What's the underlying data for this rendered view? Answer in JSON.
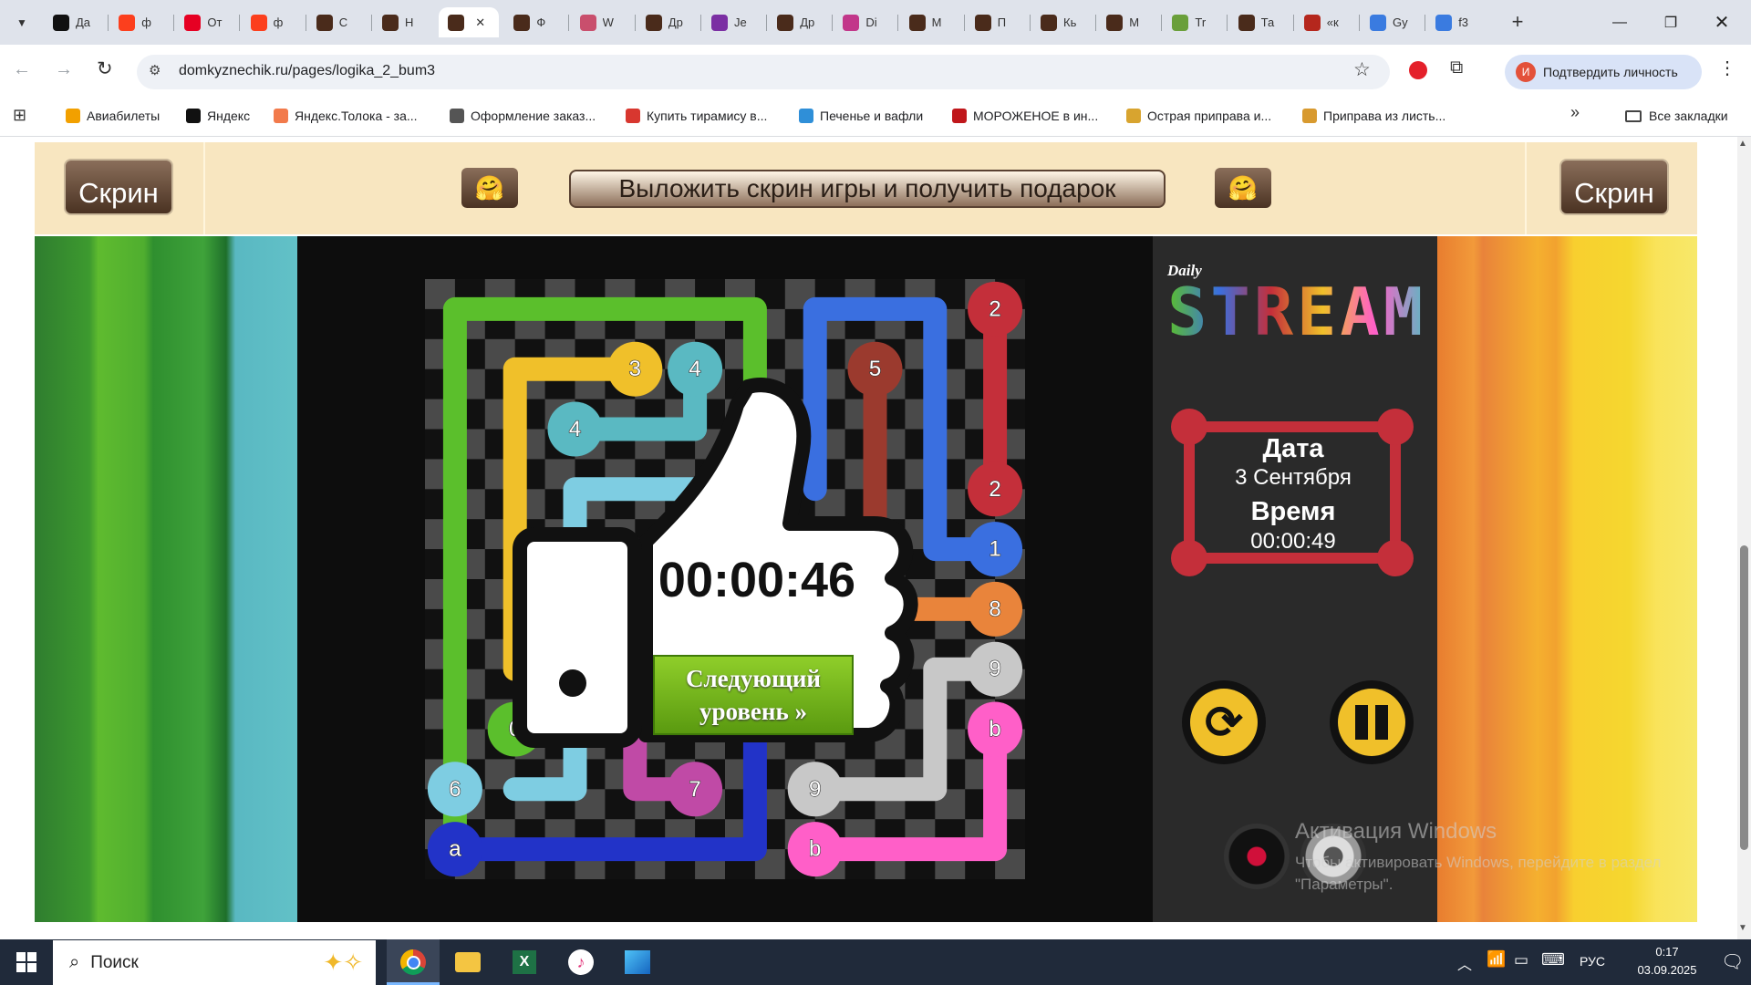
{
  "browser": {
    "tabs": [
      {
        "label": "Да",
        "color": "#111"
      },
      {
        "label": "ф",
        "color": "#fc3f1d"
      },
      {
        "label": "От",
        "color": "#e60023"
      },
      {
        "label": "ф",
        "color": "#fc3f1d"
      },
      {
        "label": "С",
        "color": "#4a2b1b"
      },
      {
        "label": "Н",
        "color": "#4a2b1b"
      },
      {
        "label": "",
        "color": "#4a2b1b",
        "active": true
      },
      {
        "label": "Ф",
        "color": "#4a2b1b"
      },
      {
        "label": "W",
        "color": "#c94f6d"
      },
      {
        "label": "Др",
        "color": "#4a2b1b"
      },
      {
        "label": "Je",
        "color": "#7b2fa3"
      },
      {
        "label": "Др",
        "color": "#4a2b1b"
      },
      {
        "label": "Di",
        "color": "#c2378a"
      },
      {
        "label": "М",
        "color": "#4a2b1b"
      },
      {
        "label": "П",
        "color": "#4a2b1b"
      },
      {
        "label": "Кь",
        "color": "#4a2b1b"
      },
      {
        "label": "М",
        "color": "#4a2b1b"
      },
      {
        "label": "Tr",
        "color": "#6a9f3a"
      },
      {
        "label": "Та",
        "color": "#4a2b1b"
      },
      {
        "label": "«к",
        "color": "#b5271d"
      },
      {
        "label": "Gy",
        "color": "#3a7be0"
      },
      {
        "label": "f3",
        "color": "#3a7be0"
      }
    ],
    "url": "domkyznechik.ru/pages/logika_2_bum3",
    "verify_label": "Подтвердить личность",
    "verify_avatar": "И",
    "bookmarks": [
      {
        "label": "Авиабилеты",
        "color": "#f2a000"
      },
      {
        "label": "Яндекс",
        "color": "#111"
      },
      {
        "label": "Яндекс.Толока - за...",
        "color": "#f27a4b"
      },
      {
        "label": "Оформление заказ...",
        "color": "#555"
      },
      {
        "label": "Купить тирамису в...",
        "color": "#d8372f"
      },
      {
        "label": "Печенье и вафли",
        "color": "#2f8fd8"
      },
      {
        "label": "МОРОЖЕНОЕ в ин...",
        "color": "#c0171b"
      },
      {
        "label": "Острая приправа и...",
        "color": "#d8a42f"
      },
      {
        "label": "Приправа из листь...",
        "color": "#d89a2f"
      }
    ],
    "all_bookmarks": "Все закладки"
  },
  "game": {
    "screen_button": "Скрин",
    "banner": "Выложить скрин игры и получить подарок",
    "logo_small": "Daily",
    "logo_big": "STREAM",
    "date_label": "Дата",
    "date_value": "3 Сентября",
    "time_label": "Время",
    "time_value": "00:00:49",
    "result_time": "00:00:46",
    "next_level": "Следующий уровень »",
    "board_numbers": [
      "2",
      "3",
      "4",
      "5",
      "4",
      "2",
      "1",
      "8",
      "9",
      "0",
      "6",
      "7",
      "9",
      "b",
      "a",
      "b"
    ],
    "colors": {
      "green": "#5bbf2c",
      "yellow": "#f0c02a",
      "teal": "#5ab9c2",
      "lightblue": "#7ecde2",
      "red": "#c42f3a",
      "brown": "#9b3a2e",
      "blue": "#3a6fe0",
      "orange": "#e9843b",
      "gray": "#c8c8c8",
      "pink": "#ff5fc8",
      "navy": "#2233c8",
      "magenta": "#c04aa6"
    }
  },
  "watermark": {
    "title": "Активация Windows",
    "line1": "Чтобы активировать Windows, перейдите в раздел",
    "line2": "\"Параметры\"."
  },
  "taskbar": {
    "search": "Поиск",
    "lang": "РУС",
    "time": "0:17",
    "date": "03.09.2025"
  }
}
